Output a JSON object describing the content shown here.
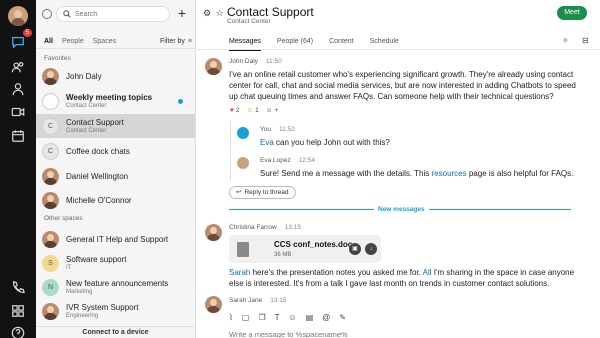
{
  "rail": {
    "chat_badge": "5"
  },
  "list": {
    "search_placeholder": "Search",
    "add": "+",
    "filters": [
      "All",
      "People",
      "Spaces"
    ],
    "filter_by": "Filter by",
    "favorites_label": "Favorites",
    "favorites": [
      {
        "name": "John Daly",
        "sub": "",
        "avatar": "photo",
        "bold": false
      },
      {
        "name": "Weekly meeting topics",
        "sub": "Contact Center",
        "avatar": "wh",
        "bold": true,
        "unread": true
      },
      {
        "name": "Contact Support",
        "sub": "Contact Center",
        "avatar": "C",
        "bold": false,
        "selected": true
      },
      {
        "name": "Coffee dock chats",
        "sub": "",
        "avatar": "C",
        "bold": false
      },
      {
        "name": "Daniel Wellington",
        "sub": "",
        "avatar": "photo",
        "bold": false
      },
      {
        "name": "Michelle O'Connor",
        "sub": "",
        "avatar": "photo",
        "bold": false
      }
    ],
    "other_label": "Other spaces",
    "others": [
      {
        "name": "General IT Help and Support",
        "sub": "",
        "avatar": "photo",
        "bold": false
      },
      {
        "name": "Software support",
        "sub": "IT",
        "avatar": "S",
        "bold": false
      },
      {
        "name": "New feature announcements",
        "sub": "Marketing",
        "avatar": "N",
        "bold": false
      },
      {
        "name": "IVR System Support",
        "sub": "Engineering",
        "avatar": "photo",
        "bold": false
      }
    ],
    "connect": "Connect to a device"
  },
  "header": {
    "title": "Contact Support",
    "subtitle": "Contact Center",
    "meet": "Meet",
    "tabs": [
      "Messages",
      "People (64)",
      "Content",
      "Schedule"
    ]
  },
  "messages": {
    "m1": {
      "author": "John Daly",
      "time": "11:50",
      "text": "I've an online retail customer who's experiencing significant growth. They're already using contact center for call, chat and social media services, but are now interested in adding Chatbots to speed up chat queuing times and answer FAQs. Can someone help with their technical questions?",
      "reactions": [
        {
          "icon": "❤️",
          "count": "2"
        },
        {
          "icon": "😄",
          "count": "1"
        },
        {
          "icon": "☺",
          "count": "+"
        }
      ]
    },
    "r1": {
      "author": "You",
      "time": "11:52",
      "mention": "Eva",
      "text": " can you help John out with this?"
    },
    "r2": {
      "author": "Eva Lopez",
      "time": "12:54",
      "text_before": "Sure! Send me a message with the details. This ",
      "link": "resources",
      "text_after": " page is also helpful for FAQs."
    },
    "reply_to_thread": "Reply to thread",
    "new_messages": "New messages",
    "m2": {
      "author": "Christina Farrow",
      "time": "13:15",
      "file_name": "CCS conf_notes.doc",
      "file_size": "36 MB",
      "mention1": "Sarah",
      "text1": " here's the presentation notes you asked me for.  ",
      "mention2": "All",
      "text2": " I'm sharing in the space in case anyone else is interested. It's from a talk I gave last month on trends in customer contact solutions."
    },
    "m3": {
      "author": "Sarah Jane",
      "time": "13:15"
    }
  },
  "composer": {
    "placeholder": "Write a message to %spacename%"
  }
}
